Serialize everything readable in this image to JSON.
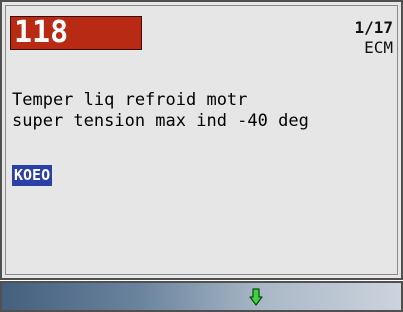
{
  "dtc": {
    "code": "118",
    "page": "1/17",
    "module": "ECM"
  },
  "description": {
    "line1": "Temper liq refroid motr",
    "line2": "super tension max ind -40 deg"
  },
  "status": {
    "label": "KOEO"
  },
  "footer": {
    "icon": "arrow-down-icon",
    "colors": {
      "arrow": "#40d040",
      "code_bg": "#b82a14",
      "status_bg": "#2a3fa8"
    }
  }
}
